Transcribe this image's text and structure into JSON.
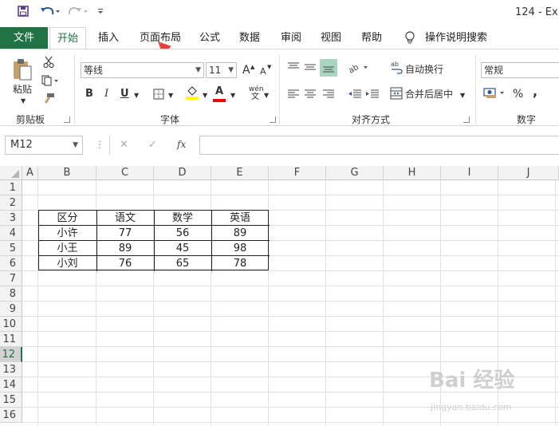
{
  "titlebar": {
    "title": "124 - Ex",
    "qat": {
      "save_icon": "save-icon",
      "undo_icon": "undo-icon",
      "redo_icon": "redo-icon",
      "customize_icon": "customize-qat-icon"
    }
  },
  "tabs": {
    "file": "文件",
    "items": [
      "开始",
      "插入",
      "页面布局",
      "公式",
      "数据",
      "审阅",
      "视图",
      "帮助"
    ],
    "search_label": "操作说明搜索"
  },
  "ribbon": {
    "clipboard": {
      "label": "剪贴板",
      "paste": "粘贴"
    },
    "font": {
      "label": "字体",
      "font_name": "等线",
      "font_size": "11",
      "bold": "B",
      "italic": "I",
      "underline": "U",
      "grow": "A",
      "shrink": "A",
      "font_color_letter": "A",
      "phonetic_top": "wén",
      "phonetic_bottom": "文"
    },
    "alignment": {
      "label": "对齐方式",
      "wrap_text": "自动换行",
      "merge_center": "合并后居中"
    },
    "number": {
      "label": "数字",
      "format": "常规",
      "percent": "%",
      "comma": ","
    }
  },
  "formula_bar": {
    "name_box": "M12",
    "cancel": "✕",
    "enter": "✓",
    "fx": "fx",
    "value": ""
  },
  "grid": {
    "columns": [
      "A",
      "B",
      "C",
      "D",
      "E",
      "F",
      "G",
      "H",
      "I",
      "J"
    ],
    "rows": [
      "1",
      "2",
      "3",
      "4",
      "5",
      "6",
      "7",
      "8",
      "9",
      "10",
      "11",
      "12",
      "13",
      "14",
      "15",
      "16"
    ],
    "selected_row": "12"
  },
  "table": {
    "header": [
      "区分",
      "语文",
      "数学",
      "英语"
    ],
    "rows": [
      [
        "小许",
        "77",
        "56",
        "89"
      ],
      [
        "小王",
        "89",
        "45",
        "98"
      ],
      [
        "小刘",
        "76",
        "65",
        "78"
      ]
    ]
  },
  "watermark": {
    "text": "Bai 经验",
    "url": "jingyan.baidu.com"
  },
  "colors": {
    "excel_green": "#217346",
    "arrow_red": "#e8403a",
    "highlight_yellow": "#ffff00",
    "font_red": "#ff0000"
  }
}
